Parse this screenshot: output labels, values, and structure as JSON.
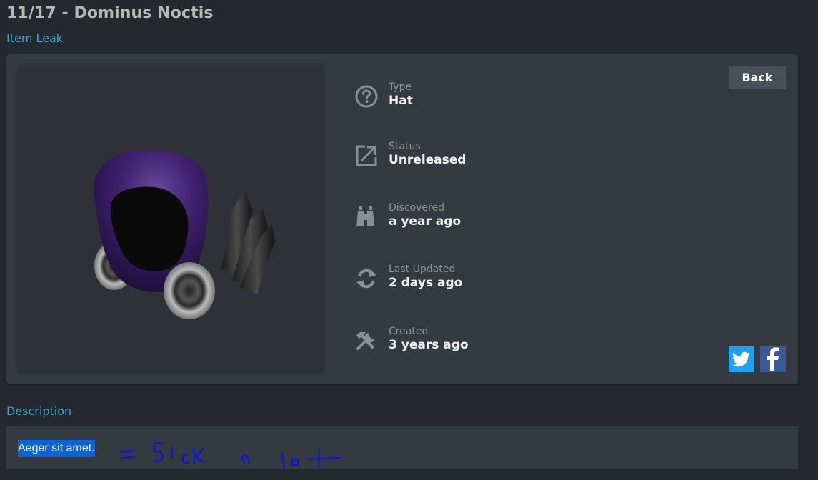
{
  "page": {
    "title": "11/17 - Dominus Noctis",
    "subtitle": "Item Leak"
  },
  "item": {
    "image_alt": "Dominus Noctis",
    "details": [
      {
        "icon": "question-circle-icon",
        "label": "Type",
        "value": "Hat"
      },
      {
        "icon": "external-link-icon",
        "label": "Status",
        "value": "Unreleased"
      },
      {
        "icon": "binoculars-icon",
        "label": "Discovered",
        "value": "a year ago"
      },
      {
        "icon": "sync-icon",
        "label": "Last Updated",
        "value": "2 days ago"
      },
      {
        "icon": "tools-icon",
        "label": "Created",
        "value": "3 years ago"
      }
    ]
  },
  "actions": {
    "back_label": "Back",
    "share": [
      {
        "name": "twitter",
        "color": "#1da1f2"
      },
      {
        "name": "facebook",
        "color": "#3b5998"
      }
    ]
  },
  "description": {
    "heading": "Description",
    "text": "Aeger sit amet.",
    "annotation": "= Sick a lot"
  },
  "colors": {
    "accent": "#3ba4c8",
    "selection": "#0a64d6",
    "annotation_ink": "#0a14e6"
  }
}
